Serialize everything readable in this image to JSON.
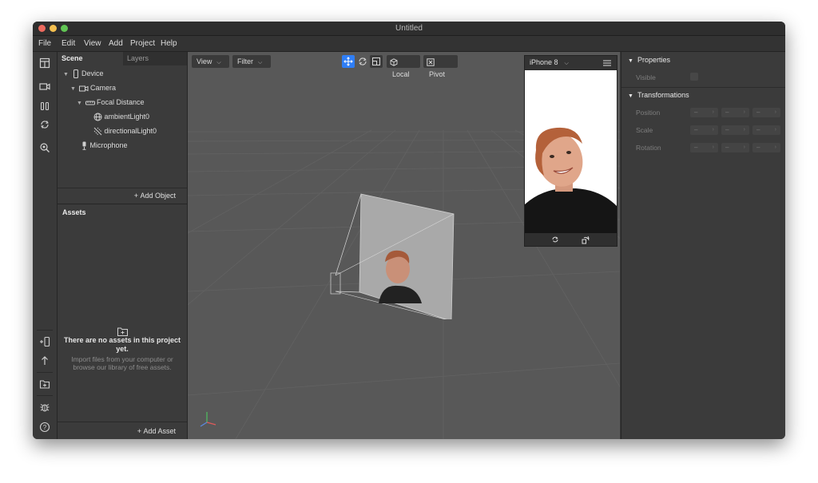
{
  "window": {
    "title": "Untitled"
  },
  "menu": [
    "File",
    "Edit",
    "View",
    "Add",
    "Project",
    "Help"
  ],
  "toolstrip": {
    "top": [
      "layout-icon",
      "camera-icon",
      "pause-icon",
      "refresh-icon",
      "zoom-icon"
    ],
    "bottom": [
      "add-device-icon",
      "upload-icon",
      "export-icon",
      "bug-icon",
      "help-icon"
    ]
  },
  "scene_panel": {
    "tabs": {
      "scene": "Scene",
      "layers": "Layers"
    },
    "tree": [
      {
        "label": "Device",
        "icon": "device-icon",
        "expanded": true
      },
      {
        "label": "Camera",
        "icon": "camera-icon",
        "expanded": true
      },
      {
        "label": "Focal Distance",
        "icon": "focal-distance-icon",
        "expanded": true
      },
      {
        "label": "ambientLight0",
        "icon": "ambient-light-icon"
      },
      {
        "label": "directionalLight0",
        "icon": "directional-light-icon"
      },
      {
        "label": "Microphone",
        "icon": "microphone-icon"
      }
    ],
    "add_object": "Add Object",
    "assets_title": "Assets",
    "empty_title": "There are no assets in this project yet.",
    "empty_sub": "Import files from your computer or browse our library of free assets.",
    "add_asset": "Add Asset"
  },
  "viewport": {
    "view_label": "View",
    "filter_label": "Filter",
    "local_label": "Local",
    "pivot_label": "Pivot",
    "active_tool": "move"
  },
  "simulator": {
    "device": "iPhone 8"
  },
  "properties": {
    "section_properties": "Properties",
    "visible_label": "Visible",
    "section_transformations": "Transformations",
    "position_label": "Position",
    "scale_label": "Scale",
    "rotation_label": "Rotation",
    "field_placeholder": "–"
  },
  "colors": {
    "accent": "#2f7ef6",
    "panel": "#3b3b3b",
    "viewport": "#585858"
  }
}
